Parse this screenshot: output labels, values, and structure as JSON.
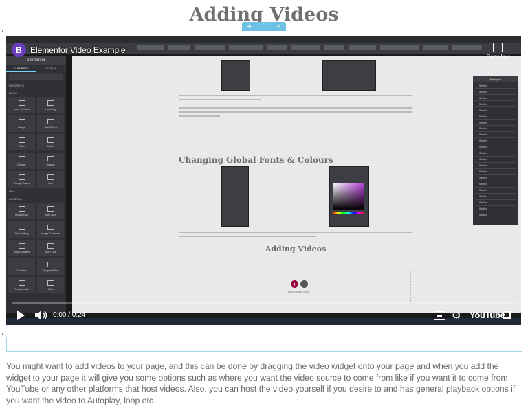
{
  "page": {
    "title": "Adding Videos",
    "body": "You might want to add videos to your page, and this can be done by dragging the video widget onto your page and when you add the widget to your page it will give you some options such as where you want the video source to come from like if you want it to come from YouTube or any other platforms that host videos. Also, you can host the video yourself if you desire to and has general playback options if you want the video to Autoplay, loop etc."
  },
  "editor_handle": {
    "add": "+",
    "move": "⠿",
    "close": "×"
  },
  "video": {
    "channel_initial": "B",
    "title": "Elementor Video Example",
    "copy_link": "Copy link",
    "time": "0:00 / 0:24",
    "progress": 0,
    "brand": "YouTube",
    "accent": "#6a3fbf"
  },
  "screen": {
    "editor": {
      "brand": "elementor",
      "tabs": [
        "ELEMENTS",
        "GLOBAL"
      ],
      "sections": [
        "FAVORITES",
        "BASIC",
        "PRO",
        "GENERAL"
      ],
      "widgets": [
        "Inner Section",
        "Heading",
        "Image",
        "Text Editor",
        "Video",
        "Button",
        "Divider",
        "Spacer",
        "Google Maps",
        "Icon",
        "Image Box",
        "Icon Box",
        "Star Rating",
        "Image Carousel",
        "Basic Gallery",
        "Icon List",
        "Counter",
        "Progress Bar",
        "Testimonial",
        "Tabs"
      ]
    },
    "heading_fonts": "Changing Global Fonts & Colours",
    "heading_videos": "Adding Videos",
    "dropzone_text": "Drag widget here",
    "navigator": {
      "title": "Navigator",
      "item": "Section",
      "count": 22
    }
  }
}
